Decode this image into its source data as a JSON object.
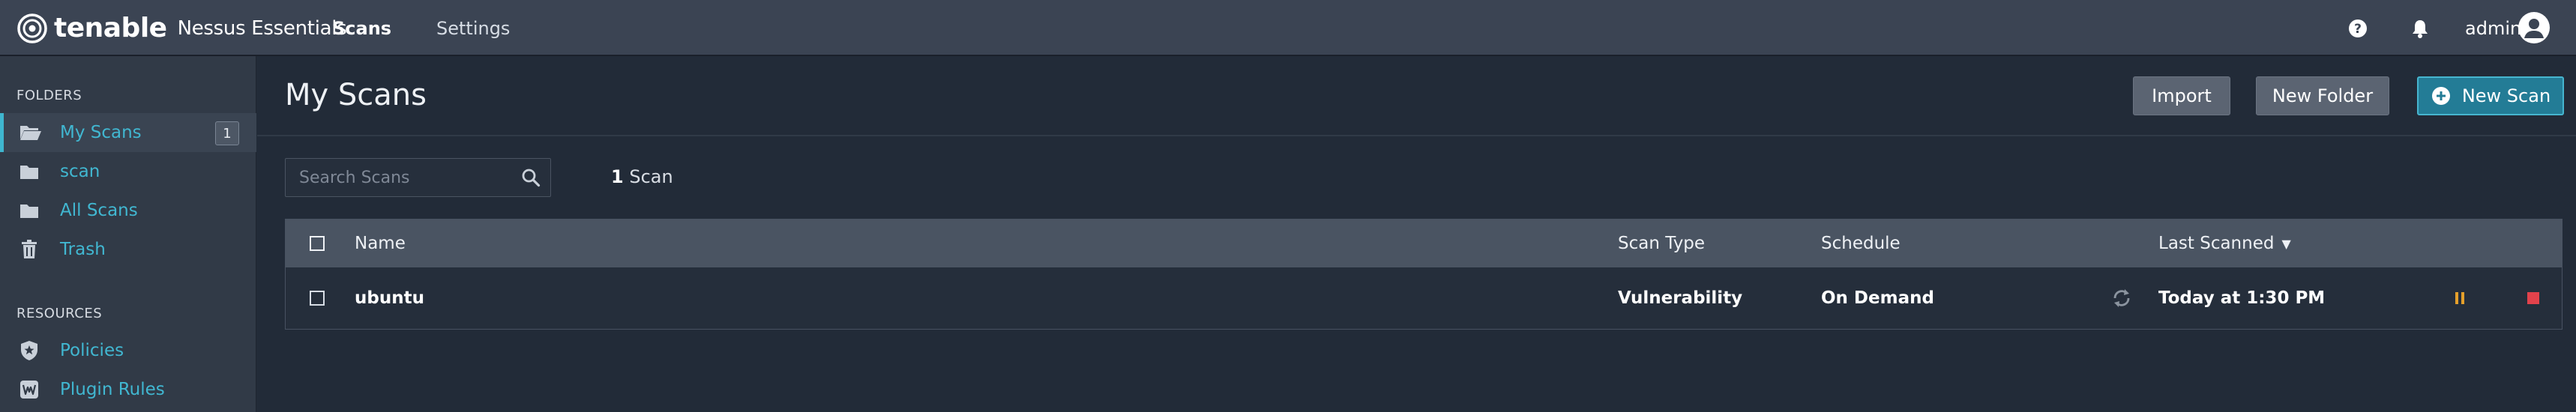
{
  "header": {
    "brand": "tenable",
    "product": "Nessus Essentials",
    "nav": [
      {
        "label": "Scans",
        "active": true
      },
      {
        "label": "Settings",
        "active": false
      }
    ],
    "user": "admin",
    "icons": [
      "help-icon",
      "bell-icon",
      "user-avatar-icon"
    ]
  },
  "sidebar": {
    "folders_heading": "FOLDERS",
    "folders": [
      {
        "label": "My Scans",
        "icon": "folder-open-icon",
        "count": "1",
        "active": true
      },
      {
        "label": "scan",
        "icon": "folder-icon"
      },
      {
        "label": "All Scans",
        "icon": "folder-icon"
      },
      {
        "label": "Trash",
        "icon": "trash-icon"
      }
    ],
    "resources_heading": "RESOURCES",
    "resources": [
      {
        "label": "Policies",
        "icon": "shield-star-icon"
      },
      {
        "label": "Plugin Rules",
        "icon": "plugin-rules-icon"
      }
    ]
  },
  "main": {
    "title": "My Scans",
    "buttons": {
      "import": "Import",
      "new_folder": "New Folder",
      "new_scan": "New Scan"
    },
    "search": {
      "placeholder": "Search Scans",
      "value": ""
    },
    "scan_count_number": "1",
    "scan_count_word": "Scan"
  },
  "table": {
    "columns": {
      "name": "Name",
      "scan_type": "Scan Type",
      "schedule": "Schedule",
      "last_scanned": "Last Scanned",
      "sort_indicator": "▼"
    },
    "rows": [
      {
        "name": "ubuntu",
        "scan_type": "Vulnerability",
        "schedule": "On Demand",
        "last_scanned": "Today at 1:30 PM",
        "status_icon": "running-spinner-icon"
      }
    ]
  },
  "colors": {
    "accent": "#41b7d1",
    "topbar": "#3b4453",
    "sidebar": "#313a47",
    "background": "#222b38",
    "new_scan_button": "#237c96",
    "pause": "#e5a02b",
    "stop": "#e2424b"
  }
}
